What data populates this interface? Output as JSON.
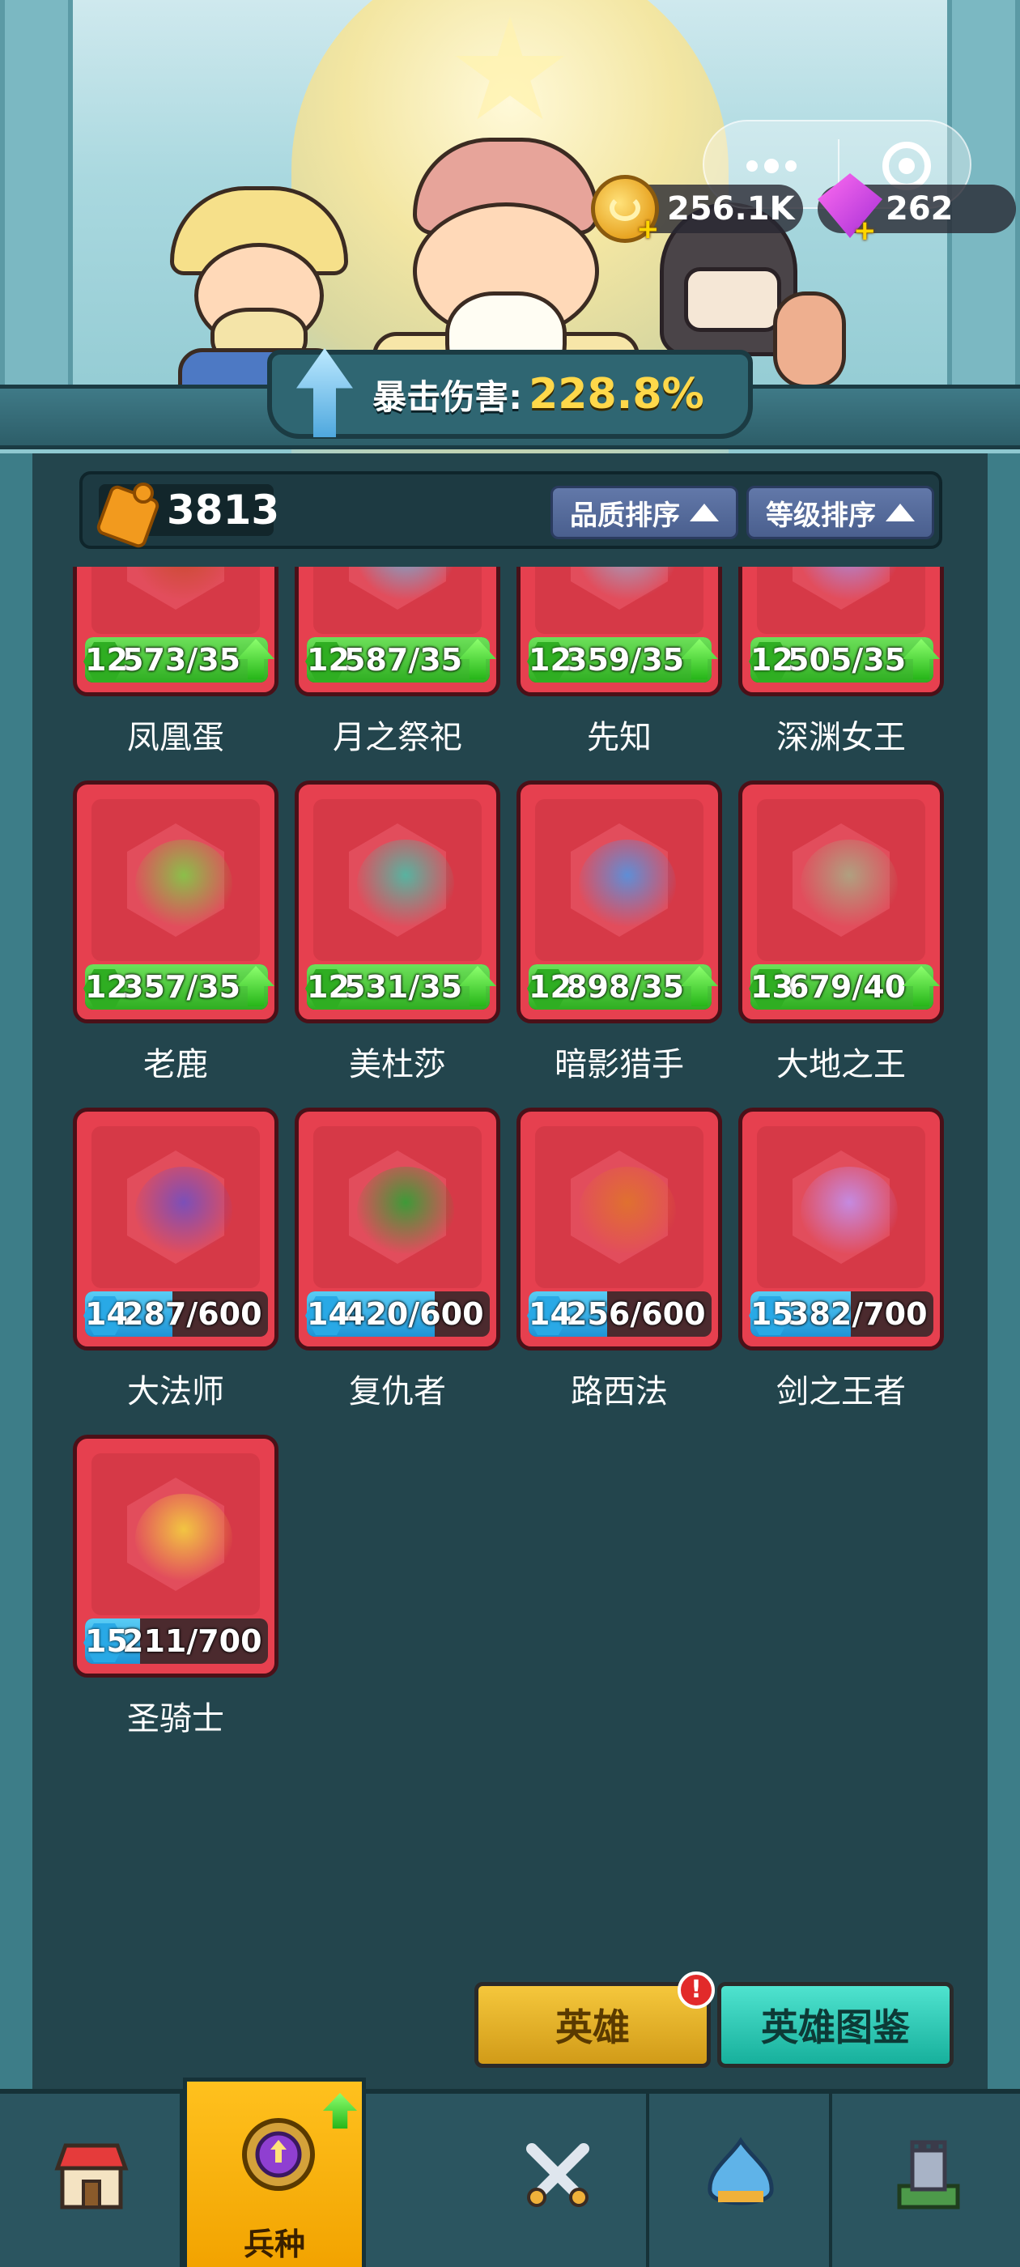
{
  "header": {
    "currency": {
      "gold": "256.1K",
      "gems": "262"
    },
    "stat": {
      "label": "暴击伤害:",
      "value": "228.8%"
    }
  },
  "toolbar": {
    "fragment_count": "3813",
    "sort_quality_label": "品质排序",
    "sort_level_label": "等级排序"
  },
  "heroes": [
    {
      "name": "凤凰蛋",
      "level": "12",
      "progress": "573/35",
      "fill": 1.0,
      "color": "green",
      "upgradable": true
    },
    {
      "name": "月之祭祀",
      "level": "12",
      "progress": "587/35",
      "fill": 1.0,
      "color": "green",
      "upgradable": true
    },
    {
      "name": "先知",
      "level": "12",
      "progress": "359/35",
      "fill": 1.0,
      "color": "green",
      "upgradable": true
    },
    {
      "name": "深渊女王",
      "level": "12",
      "progress": "505/35",
      "fill": 1.0,
      "color": "green",
      "upgradable": true
    },
    {
      "name": "老鹿",
      "level": "12",
      "progress": "357/35",
      "fill": 1.0,
      "color": "green",
      "upgradable": true
    },
    {
      "name": "美杜莎",
      "level": "12",
      "progress": "531/35",
      "fill": 1.0,
      "color": "green",
      "upgradable": true
    },
    {
      "name": "暗影猎手",
      "level": "12",
      "progress": "898/35",
      "fill": 1.0,
      "color": "green",
      "upgradable": true
    },
    {
      "name": "大地之王",
      "level": "13",
      "progress": "679/40",
      "fill": 1.0,
      "color": "green",
      "upgradable": true
    },
    {
      "name": "大法师",
      "level": "14",
      "progress": "287/600",
      "fill": 0.48,
      "color": "blue",
      "upgradable": false
    },
    {
      "name": "复仇者",
      "level": "14",
      "progress": "420/600",
      "fill": 0.7,
      "color": "blue",
      "upgradable": false
    },
    {
      "name": "路西法",
      "level": "14",
      "progress": "256/600",
      "fill": 0.43,
      "color": "blue",
      "upgradable": false
    },
    {
      "name": "剑之王者",
      "level": "15",
      "progress": "382/700",
      "fill": 0.55,
      "color": "blue",
      "upgradable": false
    },
    {
      "name": "圣骑士",
      "level": "15",
      "progress": "211/700",
      "fill": 0.3,
      "color": "blue",
      "upgradable": false
    }
  ],
  "actions": {
    "hero_label": "英雄",
    "hero_alert": "!",
    "codex_label": "英雄图鉴"
  },
  "nav": {
    "active_label": "兵种"
  },
  "colors": {
    "card_red": "#e6404f",
    "bar_green": "#2fae22",
    "bar_blue": "#29a9e6",
    "nav_active": "#ffc11e"
  }
}
